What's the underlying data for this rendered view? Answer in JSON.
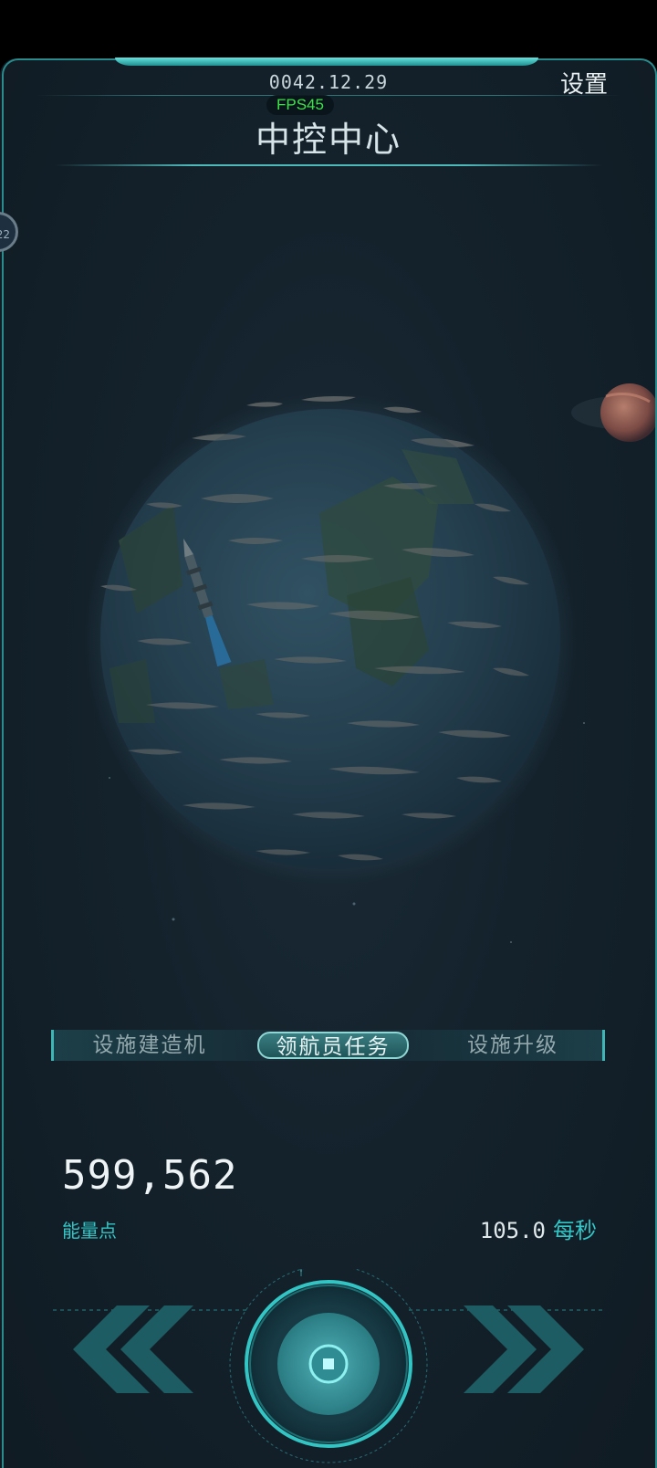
{
  "header": {
    "date": "0042.12.29",
    "fps": "FPS45",
    "title": "中控中心",
    "settings_label": "设置"
  },
  "side_badge": "22",
  "tabs": [
    {
      "label": "设施建造机",
      "active": false
    },
    {
      "label": "领航员任务",
      "active": true
    },
    {
      "label": "设施升级",
      "active": false
    }
  ],
  "resources": {
    "energy_value": "599,562",
    "energy_label": "能量点",
    "rate_value": "105.0",
    "rate_unit": "每秒"
  },
  "colors": {
    "accent": "#31c7c7",
    "frame_border": "#2a8a8c",
    "fps_green": "#3fe14a",
    "background": "#14222c"
  },
  "icons": {
    "prev": "double-chevron-left-icon",
    "center": "core-button-icon",
    "next": "double-chevron-right-icon"
  }
}
